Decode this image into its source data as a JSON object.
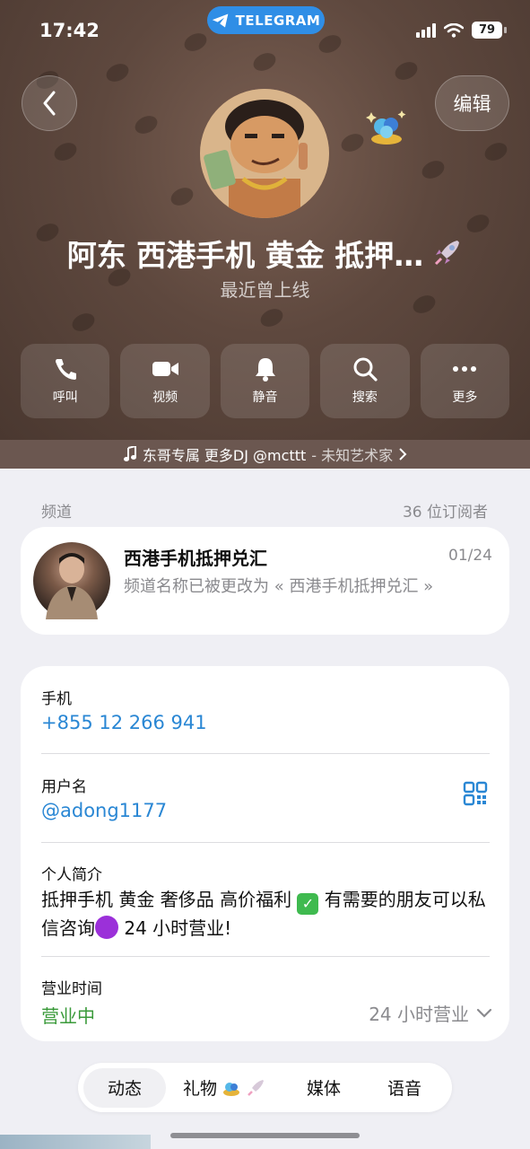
{
  "status_bar": {
    "time": "17:42",
    "app_pill": "TELEGRAM",
    "battery": "79"
  },
  "header": {
    "edit_label": "编辑",
    "name": "阿东 西港手机 黄金 抵押…",
    "last_seen": "最近曾上线"
  },
  "actions": [
    {
      "label": "呼叫",
      "icon": "phone-icon"
    },
    {
      "label": "视频",
      "icon": "video-icon"
    },
    {
      "label": "静音",
      "icon": "bell-icon"
    },
    {
      "label": "搜索",
      "icon": "search-icon"
    },
    {
      "label": "更多",
      "icon": "more-icon"
    }
  ],
  "music": {
    "title": "东哥专属 更多DJ @mcttt",
    "artist": "- 未知艺术家"
  },
  "channel_section": {
    "label": "频道",
    "subscribers": "36 位订阅者"
  },
  "channel": {
    "title": "西港手机抵押兑汇",
    "date": "01/24",
    "message": "频道名称已被更改为 « 西港手机抵押兑汇 »"
  },
  "info": {
    "phone_label": "手机",
    "phone_value": "+855 12 266 941",
    "username_label": "用户名",
    "username_value": "@adong1177",
    "bio_label": "个人简介",
    "bio_part1": "抵押手机 黄金 奢侈品 高价福利",
    "bio_part2": " 有需要的朋友可以私信咨询",
    "bio_part3": " 24 小时营业!",
    "hours_label": "营业时间",
    "hours_status": "营业中",
    "hours_detail": "24 小时营业"
  },
  "tabs": [
    {
      "label": "动态",
      "active": true
    },
    {
      "label": "礼物",
      "active": false
    },
    {
      "label": "媒体",
      "active": false
    },
    {
      "label": "语音",
      "active": false
    }
  ],
  "colors": {
    "accent": "#2a87d4",
    "open_green": "#3a9a3a",
    "header_brown": "#5e483e"
  }
}
